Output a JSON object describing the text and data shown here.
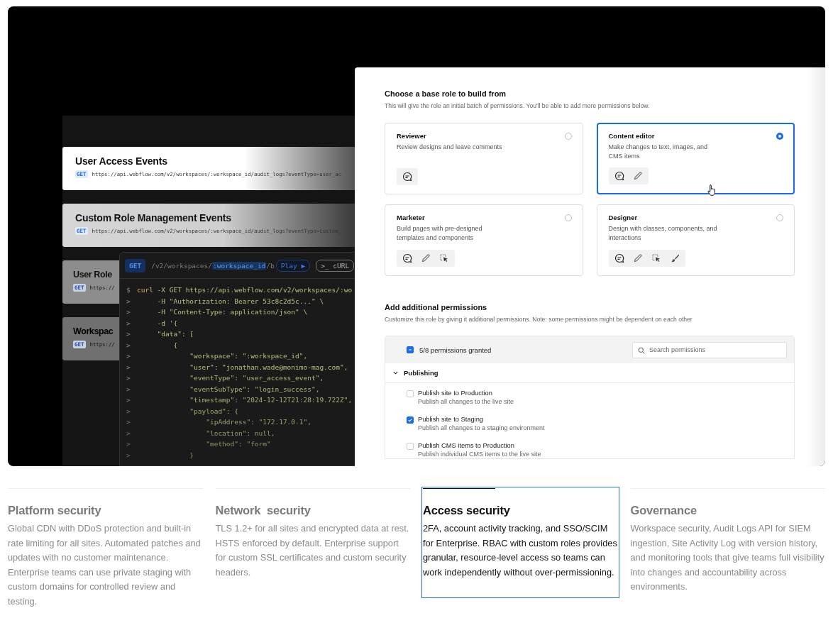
{
  "api_endpoints": [
    {
      "title": "User Access Events",
      "method": "GET",
      "url": "https://api.webflow.com/v2/workspaces/:workspace_id/audit_logs?eventType=user_ac"
    },
    {
      "title": "Custom Role Management Events",
      "method": "GET",
      "url": "https://api.webflow.com/v2/workspaces/:workspace_id/audit_logs?eventType=custom_"
    },
    {
      "title": "User Role",
      "method": "GET",
      "url": "https://"
    },
    {
      "title": "Workspac",
      "method": "GET",
      "url": "https://"
    }
  ],
  "request": {
    "method": "GET",
    "path": [
      {
        "text": "/v2/workspaces/",
        "highlight": false
      },
      {
        "text": ":workspace_id",
        "highlight": true
      },
      {
        "text": "/b",
        "highlight": false
      }
    ],
    "play_button": {
      "label": "Play",
      "glyph": "▶"
    },
    "format": {
      "glyph": ">_",
      "label": "cURL"
    },
    "code_lines": [
      {
        "prompt": "$",
        "kind": "command",
        "command": "curl",
        "text": " -X GET https://api.webflow.com/v2/workspaces/:wo"
      },
      {
        "prompt": ">",
        "kind": "code",
        "text": "     -H \"Authorization: Bearer 53c8c2d5c...\" \\"
      },
      {
        "prompt": ">",
        "kind": "code",
        "text": "     -H \"Content-Type: application/json\" \\"
      },
      {
        "prompt": ">",
        "kind": "code",
        "text": "     -d '{"
      },
      {
        "prompt": ">",
        "kind": "code",
        "text": "     \"data\": ["
      },
      {
        "prompt": ">",
        "kind": "code",
        "text": "         {"
      },
      {
        "prompt": ">",
        "kind": "code",
        "text": "             \"workspace\": \":workspace_id\","
      },
      {
        "prompt": ">",
        "kind": "code",
        "text": "             \"user\": \"jonathan.wade@monimo-mag.com\","
      },
      {
        "prompt": ">",
        "kind": "code",
        "text": "             \"eventType\": \"user_access_event\","
      },
      {
        "prompt": ">",
        "kind": "code",
        "text": "             \"eventSubType\": \"login_success\","
      },
      {
        "prompt": ">",
        "kind": "code",
        "text": "             \"timestamp\": \"2024-12-12T21:28:19.722Z\","
      },
      {
        "prompt": ">",
        "kind": "code",
        "text": "             \"payload\": {"
      },
      {
        "prompt": ">",
        "kind": "code",
        "text": "                 \"ipAddress\": \"172.17.0.1\","
      },
      {
        "prompt": ">",
        "kind": "code",
        "text": "                 \"location\": null,"
      },
      {
        "prompt": ">",
        "kind": "code",
        "text": "                 \"method\": \"form\""
      },
      {
        "prompt": ">",
        "kind": "code",
        "text": "             }"
      }
    ]
  },
  "role_panel": {
    "title": "Choose a base role to build from",
    "subtitle": "This will give the role an initial batch of permissions. You'll be able to add more permissions below.",
    "roles": [
      {
        "name": "Reviewer",
        "description": "Review designs and leave comments",
        "selected": false,
        "permissions": [
          {
            "kind": "comment"
          }
        ]
      },
      {
        "name": "Content editor",
        "description": "Make changes to text, images, and CMS items",
        "selected": true,
        "permissions": [
          {
            "kind": "comment"
          },
          {
            "kind": "edit"
          }
        ]
      },
      {
        "name": "Marketer",
        "description": "Build pages with pre-designed templates and components",
        "selected": false,
        "permissions": [
          {
            "kind": "comment"
          },
          {
            "kind": "edit"
          },
          {
            "kind": "select"
          }
        ]
      },
      {
        "name": "Designer",
        "description": "Design with classes, components, and interactions",
        "selected": false,
        "permissions": [
          {
            "kind": "comment"
          },
          {
            "kind": "edit"
          },
          {
            "kind": "select"
          },
          {
            "kind": "style"
          }
        ]
      }
    ]
  },
  "permissions_panel": {
    "title": "Add additional permissions",
    "subtitle": "Customize this role by giving it additional permissions. Note: some permissions might be dependent on each other",
    "summary": {
      "text": "5/8 permissions granted",
      "indeterminate": true
    },
    "search": {
      "placeholder": "Search permissions"
    },
    "groups": [
      {
        "name": "Publishing",
        "expanded": true,
        "items": [
          {
            "title": "Publish site to Production",
            "description": "Publish all changes to the live site",
            "checked": false
          },
          {
            "title": "Publish site to Staging",
            "description": "Publish all changes to a staging environment",
            "checked": true
          },
          {
            "title": "Publish CMS items to Production",
            "description": "Publish individual CMS items to the live site",
            "checked": false
          }
        ]
      }
    ]
  },
  "features": [
    {
      "title": "Platform security",
      "body": "Global CDN with DDoS protection and built-in rate limiting for all sites. Automated patches and updates with no customer maintenance. Enterprise teams can use private staging with custom domains for controlled review and testing.",
      "selected": false
    },
    {
      "title": "Network  security",
      "body": "TLS 1.2+ for all sites and encrypted data at rest. HSTS enforced by default. Enterprise support for custom SSL certificates and custom security headers.",
      "selected": false
    },
    {
      "title": "Access security",
      "body": "2FA, account activity tracking, and SSO/SCIM for Enterprise. RBAC with custom roles provides granular, resource-level access so teams can work independently without over-permissioning.",
      "selected": true,
      "level": 0.37
    },
    {
      "title": "Governance",
      "body": "Workspace security, Audit Logs API for SIEM ingestion, Site Activity Log with version history, and monitoring tools that give teams full visibility into changes and accountability across environments.",
      "selected": false
    }
  ]
}
